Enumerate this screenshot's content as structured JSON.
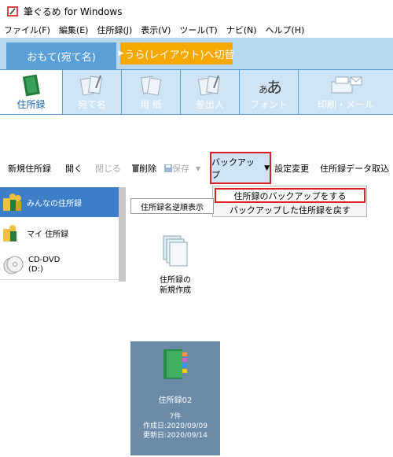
{
  "window": {
    "title": "筆ぐるめ for Windows"
  },
  "menubar": [
    "ファイル(F)",
    "編集(E)",
    "住所録(J)",
    "表示(V)",
    "ツール(T)",
    "ナビ(N)",
    "ヘルプ(H)"
  ],
  "tabs": {
    "front": "おもて(宛て名)",
    "back": "うら(レイアウト)へ切替"
  },
  "ribbon": [
    {
      "label": "住所録",
      "icon": "address-book-icon",
      "active": true
    },
    {
      "label": "宛て名",
      "icon": "addressee-icon",
      "active": false
    },
    {
      "label": "用 紙",
      "icon": "paper-icon",
      "active": false
    },
    {
      "label": "差出人",
      "icon": "sender-icon",
      "active": false
    },
    {
      "label": "フォント",
      "icon": "font-icon",
      "active": false
    },
    {
      "label": "印刷・メール",
      "icon": "printer-mail-icon",
      "active": false
    }
  ],
  "toolbar": {
    "new_book": "新規住所録",
    "open": "開く",
    "close": "閉じる",
    "delete": "削除",
    "save": "保存",
    "backup": "バックアップ",
    "settings": "設定変更",
    "import": "住所録データ取込"
  },
  "dropdown": {
    "item1": "住所録のバックアップをする",
    "item2": "バックアップした住所録を戻す"
  },
  "sources": [
    {
      "label": "みんなの住所録",
      "icon": "shared-folder-icon",
      "selected": true
    },
    {
      "label": "マイ 住所録",
      "icon": "my-folder-icon",
      "selected": false
    },
    {
      "label": "CD-DVD\n(D:)",
      "icon": "cd-dvd-icon",
      "selected": false
    }
  ],
  "content": {
    "sort_button": "住所録名逆順表示",
    "new_card": {
      "label": "住所録の\n新規作成"
    },
    "book_card": {
      "name": "住所録02",
      "count": "7件",
      "created": "作成日:2020/09/09",
      "updated": "更新日:2020/09/14"
    }
  },
  "colors": {
    "accent": "#5a9fd6",
    "highlight": "#e02020",
    "orange": "#f5a800",
    "selected": "#3d7ec9"
  }
}
